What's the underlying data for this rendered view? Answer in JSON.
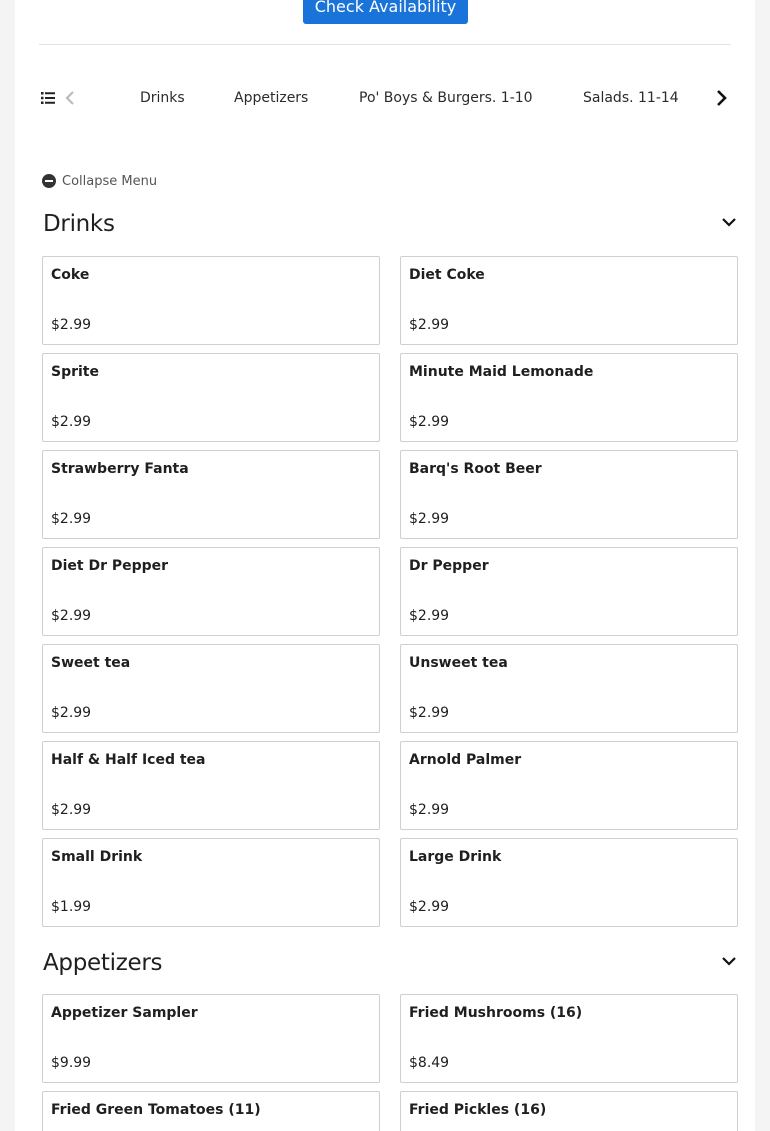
{
  "header": {
    "check_availability_label": "Check Availability"
  },
  "category_nav": {
    "tabs": [
      "Drinks",
      "Appetizers",
      "Po' Boys & Burgers. 1-10",
      "Salads. 11-14"
    ]
  },
  "menu": {
    "collapse_label": "Collapse Menu",
    "sections": [
      {
        "title": "Drinks",
        "items": [
          {
            "name": "Coke",
            "price": "$2.99"
          },
          {
            "name": "Diet Coke",
            "price": "$2.99"
          },
          {
            "name": "Sprite",
            "price": "$2.99"
          },
          {
            "name": "Minute Maid Lemonade",
            "price": "$2.99"
          },
          {
            "name": "Strawberry Fanta",
            "price": "$2.99"
          },
          {
            "name": "Barq's Root Beer",
            "price": "$2.99"
          },
          {
            "name": "Diet Dr Pepper",
            "price": "$2.99"
          },
          {
            "name": "Dr Pepper",
            "price": "$2.99"
          },
          {
            "name": "Sweet tea",
            "price": "$2.99"
          },
          {
            "name": "Unsweet tea",
            "price": "$2.99"
          },
          {
            "name": "Half & Half Iced tea",
            "price": "$2.99"
          },
          {
            "name": "Arnold Palmer",
            "price": "$2.99"
          },
          {
            "name": "Small Drink",
            "price": "$1.99"
          },
          {
            "name": "Large Drink",
            "price": "$2.99"
          }
        ]
      },
      {
        "title": "Appetizers",
        "items": [
          {
            "name": "Appetizer Sampler",
            "price": "$9.99"
          },
          {
            "name": "Fried Mushrooms (16)",
            "price": "$8.49"
          },
          {
            "name": "Fried Green Tomatoes (11)",
            "price": ""
          },
          {
            "name": "Fried Pickles (16)",
            "price": ""
          }
        ]
      }
    ]
  },
  "colors": {
    "accent": "#1a73d9",
    "card_border": "#cfcfcf",
    "page_bg": "#f4f4f4"
  }
}
